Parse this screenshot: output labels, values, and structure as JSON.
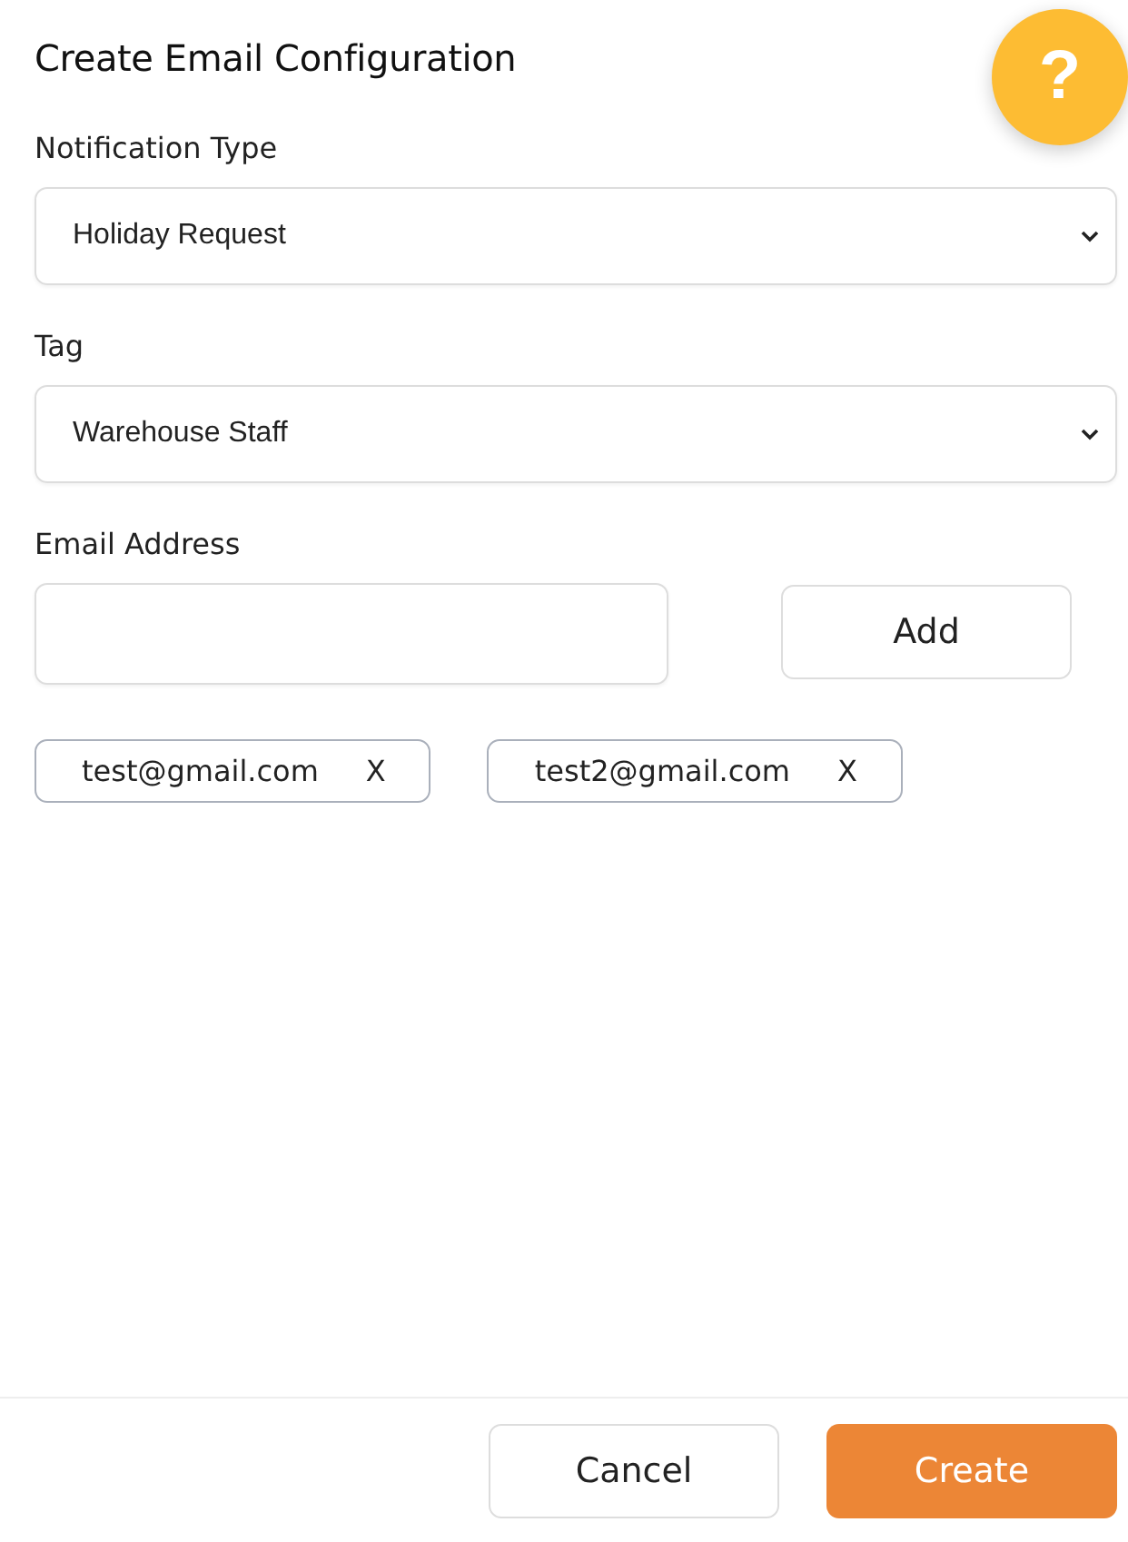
{
  "title": "Create Email Configuration",
  "help_button": {
    "label": "?"
  },
  "fields": [
    {
      "label": "Notification Type",
      "value": "Holiday Request"
    },
    {
      "label": "Tag",
      "value": "Warehouse Staff"
    }
  ],
  "email": {
    "label": "Email Address",
    "add_button": "Add"
  },
  "emails": [
    {
      "address": "test@gmail.com",
      "remove": "X"
    },
    {
      "address": "test2@gmail.com",
      "remove": "X"
    }
  ],
  "buttons": {
    "cancel": "Cancel",
    "create": "Create"
  }
}
